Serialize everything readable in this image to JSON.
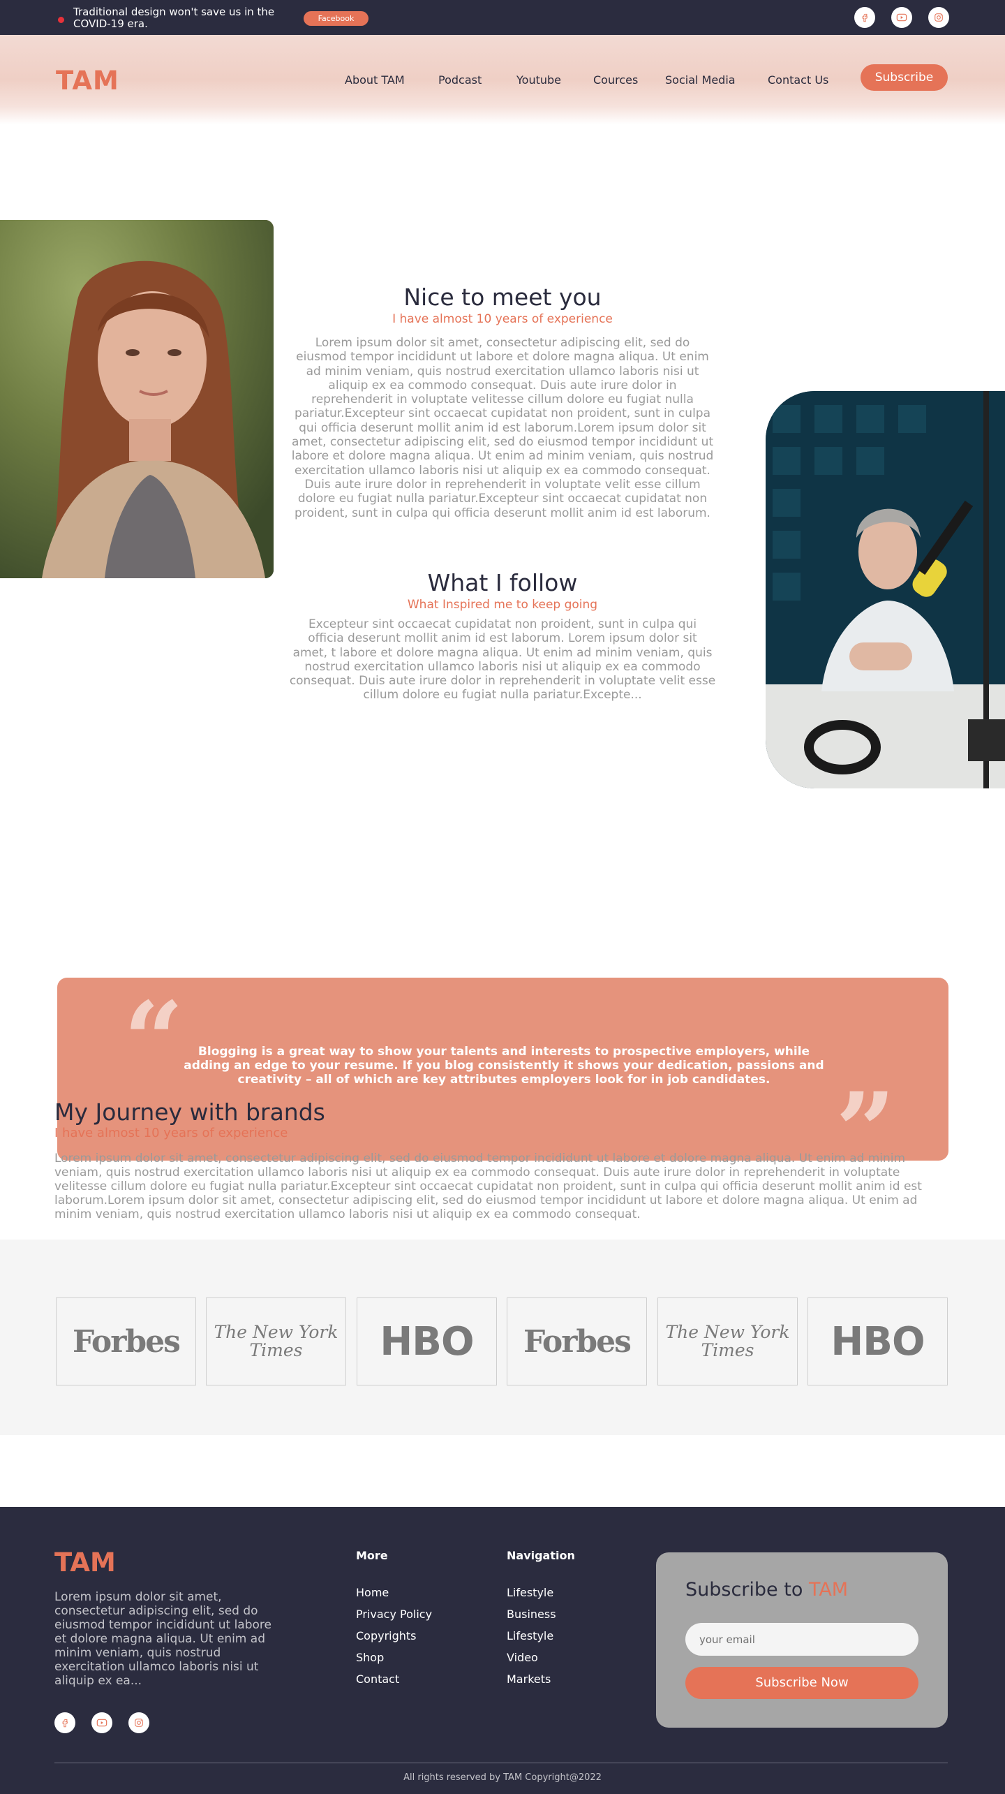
{
  "topbar": {
    "promo_text": "Traditional design won't save us in the COVID-19 era.",
    "facebook_label": "Facebook",
    "social_icons": [
      "facebook-icon",
      "youtube-icon",
      "instagram-icon"
    ]
  },
  "header": {
    "logo": "TAM",
    "nav": [
      "About  TAM",
      "Podcast",
      "Youtube",
      "Cources",
      "Social Media",
      "Contact Us"
    ],
    "subscribe_label": "Subscribe"
  },
  "about": {
    "title": "Nice to meet you",
    "subtitle": "I have almost 10 years of experience",
    "paragraph": "Lorem ipsum dolor sit amet, consectetur adipiscing elit, sed do eiusmod tempor incididunt ut labore et dolore magna aliqua. Ut enim ad minim veniam, quis nostrud exercitation ullamco laboris nisi ut aliquip ex ea commodo consequat. Duis aute irure dolor in reprehenderit in voluptate velitesse cillum dolore eu fugiat nulla pariatur.Excepteur sint occaecat cupidatat non proident, sunt in culpa qui officia deserunt mollit anim id est laborum.Lorem ipsum dolor sit amet, consectetur adipiscing elit, sed do eiusmod tempor incididunt ut labore et dolore magna aliqua. Ut enim ad minim veniam, quis nostrud exercitation ullamco laboris nisi ut aliquip ex ea commodo consequat. Duis aute irure dolor in reprehenderit in voluptate velit esse cillum dolore eu fugiat nulla pariatur.Excepteur sint occaecat cupidatat non proident, sunt in culpa qui officia deserunt mollit anim id est laborum."
  },
  "follow": {
    "title": "What I follow",
    "subtitle": "What Inspired me to keep going",
    "paragraph": "Excepteur sint occaecat cupidatat non proident, sunt in culpa qui officia deserunt mollit anim id est laborum. Lorem ipsum dolor sit amet, t labore et dolore magna aliqua. Ut enim ad minim veniam, quis nostrud exercitation ullamco laboris nisi ut aliquip ex ea commodo consequat. Duis aute irure dolor in reprehenderit in voluptate velit esse cillum dolore eu fugiat nulla pariatur.Excepte..."
  },
  "quote": {
    "open_mark": "“",
    "close_mark": "”",
    "text": "Blogging is a great way to show your talents and interests to prospective employers, while adding an edge to your resume. If you blog consistently it shows your dedication, passions and creativity – all of which are key attributes employers look for in job candidates."
  },
  "journey": {
    "title": "My Journey with brands",
    "subtitle": "I have almost 10 years of experience",
    "paragraph": "Lorem ipsum dolor sit amet, consectetur adipiscing elit, sed do eiusmod tempor incididunt ut labore et dolore magna aliqua. Ut enim ad minim veniam, quis nostrud exercitation ullamco laboris nisi ut aliquip ex ea commodo consequat. Duis aute irure dolor in reprehenderit in voluptate velitesse cillum dolore eu fugiat nulla pariatur.Excepteur sint occaecat cupidatat non proident, sunt in culpa qui officia deserunt mollit anim id est laborum.Lorem ipsum dolor sit amet, consectetur adipiscing elit, sed do eiusmod tempor incididunt ut labore et dolore magna aliqua. Ut enim ad minim veniam, quis nostrud exercitation ullamco laboris nisi ut aliquip ex ea commodo consequat."
  },
  "brands": [
    {
      "name": "Forbes",
      "kind": "forbes"
    },
    {
      "name": "The New York Times",
      "kind": "nyt"
    },
    {
      "name": "HBO",
      "kind": "hbo"
    },
    {
      "name": "Forbes",
      "kind": "forbes"
    },
    {
      "name": "The New York Times",
      "kind": "nyt"
    },
    {
      "name": "HBO",
      "kind": "hbo"
    }
  ],
  "footer": {
    "logo": "TAM",
    "description": "Lorem ipsum dolor sit amet, consectetur adipiscing elit, sed do eiusmod tempor incididunt ut labore et dolore magna aliqua. Ut enim ad minim veniam, quis nostrud exercitation ullamco laboris nisi ut aliquip ex ea...",
    "more_title": "More",
    "more_links": [
      "Home",
      "Privacy Policy",
      "Copyrights",
      "Shop",
      "Contact"
    ],
    "nav_title": "Navigation",
    "nav_links": [
      "Lifestyle",
      "Business",
      "Lifestyle",
      "Video",
      "Markets"
    ],
    "subscribe_title": "Subscribe to",
    "subscribe_title_accent": "TAM",
    "email_placeholder": "your email",
    "subscribe_button": "Subscribe Now",
    "copyright": "All rights reserved by TAM Copyright@2022"
  },
  "colors": {
    "accent": "#e57357",
    "dark": "#2b2c3f",
    "quote_bg": "#e5937c"
  }
}
